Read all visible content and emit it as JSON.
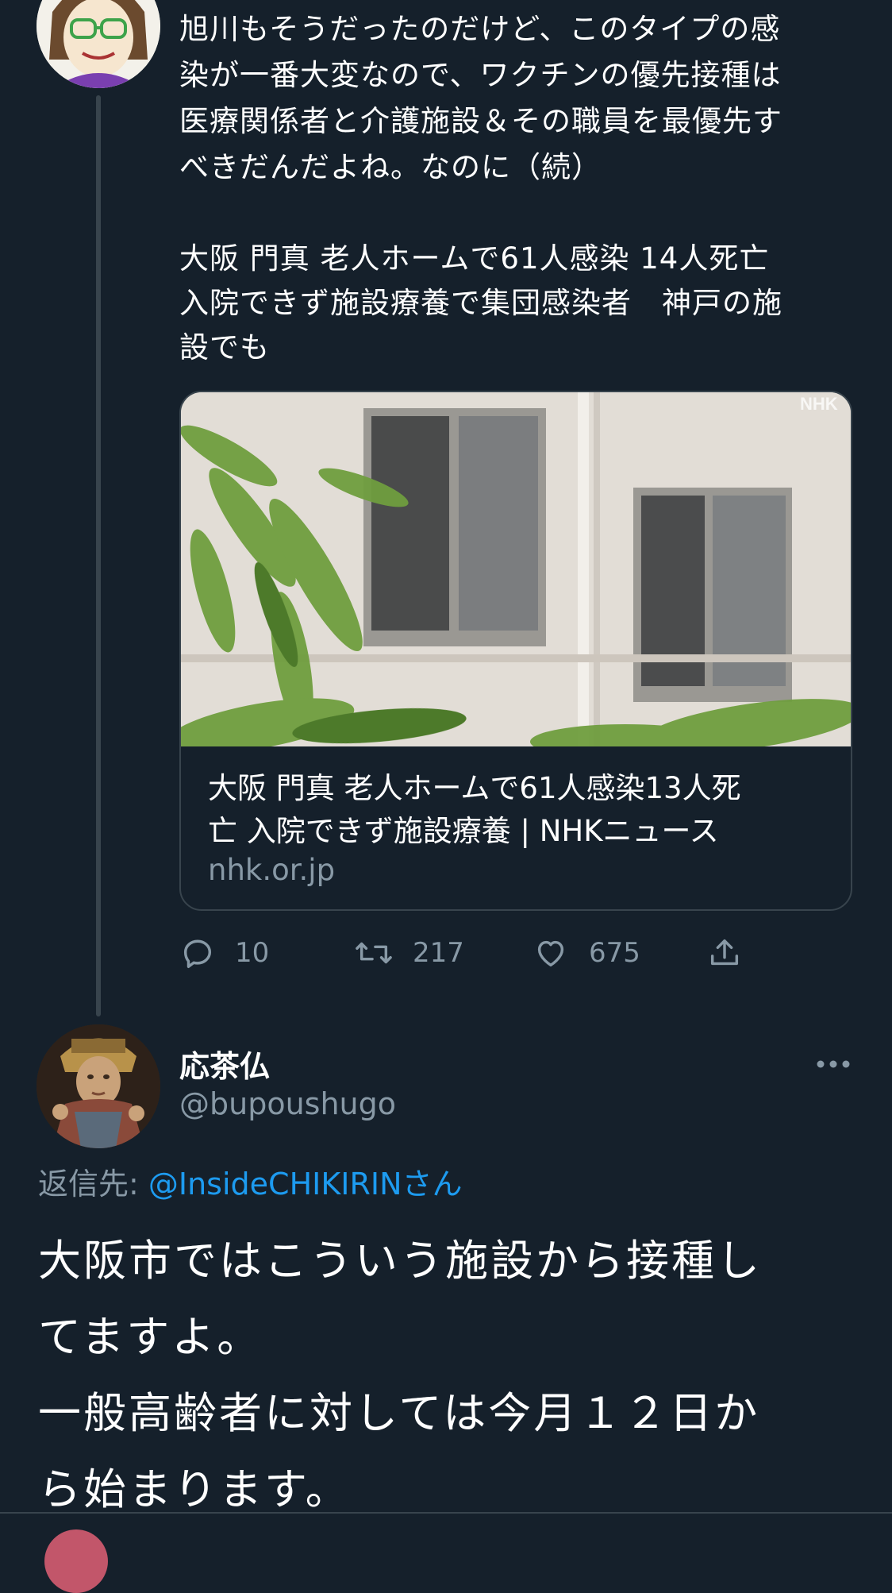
{
  "thread": {
    "tweet_text": "旭川もそうだったのだけど、このタイプの感\n染が一番大変なので、ワクチンの優先接種は\n医療関係者と介護施設＆その職員を最優先す\nべきだんだよね。なのに（続）",
    "quoted_headline": "大阪 門真 老人ホームで61人感染 14人死亡\n入院できず施設療養で集団感染者　神戸の施\n設でも"
  },
  "card": {
    "title": "大阪 門真 老人ホームで61人感染13人死\n亡 入院できず施設療養 | NHKニュース",
    "domain": "nhk.or.jp",
    "image_watermark": "NHK"
  },
  "actions": {
    "reply_count": "10",
    "retweet_count": "217",
    "like_count": "675"
  },
  "reply": {
    "display_name": "応茶仏",
    "handle": "@bupoushugo",
    "replying_to_label": "返信先: ",
    "replying_to_mention": "@InsideCHIKIRINさん",
    "body": "大阪市ではこういう施設から接種し\nてますよ。\n一般高齢者に対しては今月１２日か\nら始まります。"
  },
  "colors": {
    "background": "#15202b",
    "secondary_text": "#8899a6",
    "link": "#1d9bf0",
    "divider": "#38444d"
  },
  "icons": {
    "reply": "reply-icon",
    "retweet": "retweet-icon",
    "like": "heart-icon",
    "share": "share-icon",
    "more": "more-icon"
  }
}
